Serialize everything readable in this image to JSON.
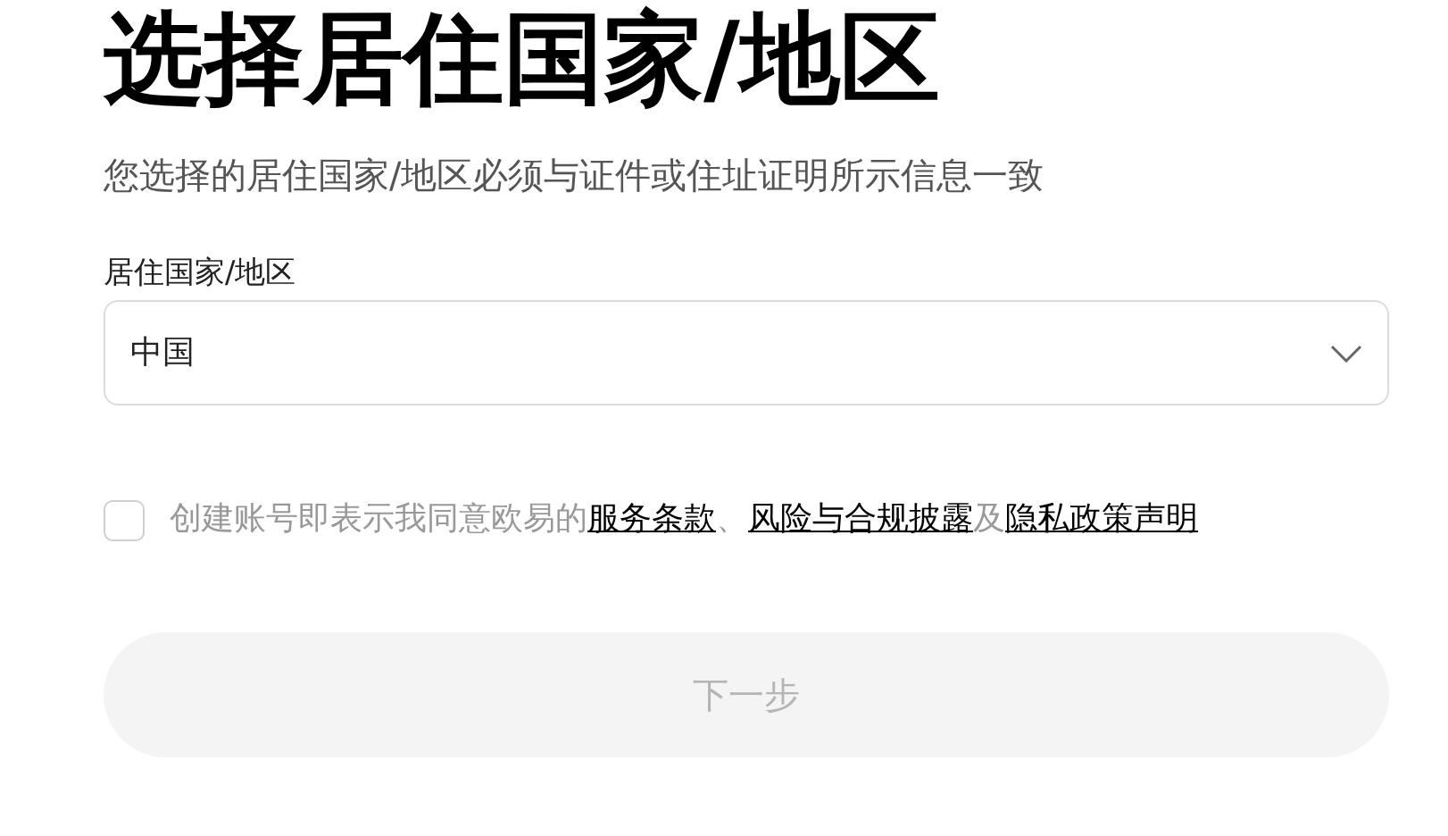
{
  "title": "选择居住国家/地区",
  "subtitle": "您选择的居住国家/地区必须与证件或住址证明所示信息一致",
  "country_field": {
    "label": "居住国家/地区",
    "value": "中国"
  },
  "consent": {
    "checked": false,
    "parts": [
      {
        "kind": "text",
        "text": "创建账号即表示我同意欧易的"
      },
      {
        "kind": "link",
        "text": "服务条款"
      },
      {
        "kind": "text",
        "text": "、"
      },
      {
        "kind": "link",
        "text": "风险与合规披露"
      },
      {
        "kind": "text",
        "text": "及"
      },
      {
        "kind": "link",
        "text": "隐私政策声明"
      }
    ]
  },
  "next_button": {
    "label": "下一步",
    "disabled": true
  }
}
